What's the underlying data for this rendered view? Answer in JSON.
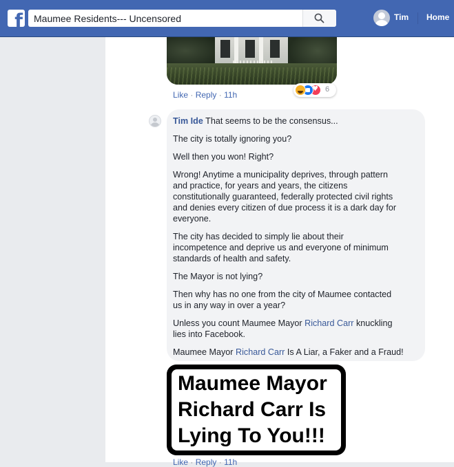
{
  "topbar": {
    "logo": "f",
    "search_value": "Maumee Residents--- Uncensored",
    "user_name": "Tim",
    "home_label": "Home"
  },
  "post_reply": {
    "like": "Like",
    "sep": "·",
    "reply": "Reply",
    "time": "11h",
    "reaction_count": "6",
    "reaction_icons": [
      "haha-icon",
      "like-icon",
      "love-icon"
    ]
  },
  "comment": {
    "author": "Tim Ide",
    "first_line": " That seems to be the consensus...",
    "p1": "The city is totally ignoring you?",
    "p2": "Well then you won! Right?",
    "p3_lines": [
      "Wrong! Anytime a municipality deprives, through pattern",
      "and practice, for years and years, the citizens",
      "constitutionally guaranteed, federally protected civil rights",
      "and denies every citizen of due process it is a dark day for",
      "everyone."
    ],
    "p4_lines": [
      "The city has decided to simply lie about their",
      "incompetence and deprive us and everyone of minimum",
      "standards of health and safety."
    ],
    "p5": "The Mayor is not lying?",
    "p6_lines": [
      "Then why has no one from the city of Maumee contacted",
      "us in any way in over a year?"
    ],
    "p7_pre": "Unless you count Maumee Mayor ",
    "p7_mention": "Richard Carr",
    "p7_post": " knuckling",
    "p7_line2": "lies into Facebook.",
    "p8_pre": "Maumee Mayor ",
    "p8_mention": "Richard Carr",
    "p8_post": " Is A Liar, a Faker and a Fraud!"
  },
  "meme": {
    "lines": [
      "Maumee Mayor",
      "Richard Carr Is",
      "Lying To You!!!"
    ]
  },
  "comment_actions": {
    "like": "Like",
    "sep": "·",
    "reply": "Reply",
    "time": "11h"
  },
  "colors": {
    "topbar": "#4267b2",
    "link": "#385898",
    "bubble": "#f2f3f5"
  }
}
